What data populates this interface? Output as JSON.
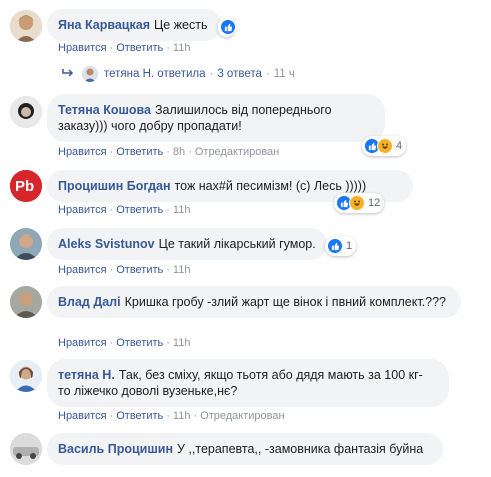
{
  "actions": {
    "like": "Нравится",
    "reply": "Ответить",
    "sep": "·",
    "edited": "Отредактирован"
  },
  "comments": [
    {
      "author": "Яна Карвацкая",
      "text": "Це жесть",
      "time": "11h",
      "reactions": {
        "count": ""
      }
    },
    {
      "author": "Тетяна Кошова",
      "text": "Залишилось від попереднього заказу))) чого добру пропадати!",
      "time": "8h",
      "edited": true,
      "reactions": {
        "count": "4"
      }
    },
    {
      "author": "Процишин Богдан",
      "text": "тож нах#й песимізм! (с) Лесь )))))",
      "time": "11h",
      "reactions": {
        "count": "12"
      }
    },
    {
      "author": "Aleks Svistunov",
      "text": "Це такий лікарський гумор.",
      "time": "11h",
      "reactions": {
        "count": "1"
      }
    },
    {
      "author": "Влад Далі",
      "text": "Кришка гробу -злий жарт ще вінок і пвний комплект.???",
      "time": "11h"
    },
    {
      "author": "тетяна Н.",
      "text": "Так, без сміху, якщо тьотя або дядя мають за 100 кг- то ліжечко доволі вузеньке,нє?",
      "time": "11h",
      "edited": true
    },
    {
      "author": "Василь Процишин",
      "text": "У ,,терапевта,, -замовника фантазія буйна",
      "time": ""
    }
  ],
  "replies": {
    "name": "тетяна Н.",
    "label": "ответила",
    "count": "3 ответа",
    "time": "11 ч"
  },
  "colors": {
    "link": "#385898",
    "bubble": "#f2f3f5",
    "like": "#1877f2",
    "haha": "#f7b125"
  }
}
